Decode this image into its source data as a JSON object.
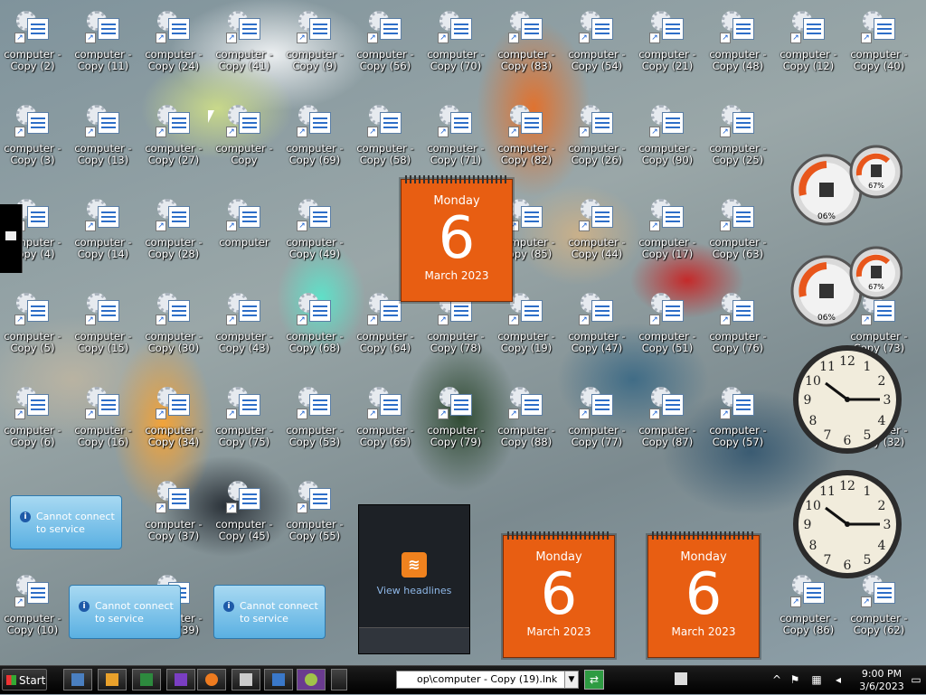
{
  "desktop": {
    "icons": [
      {
        "label1": "computer -",
        "label2": "Copy (2)",
        "col": 0,
        "row": 0
      },
      {
        "label1": "computer -",
        "label2": "Copy (11)",
        "col": 1,
        "row": 0
      },
      {
        "label1": "computer -",
        "label2": "Copy (24)",
        "col": 2,
        "row": 0
      },
      {
        "label1": "computer -",
        "label2": "Copy (41)",
        "col": 3,
        "row": 0
      },
      {
        "label1": "computer -",
        "label2": "Copy (9)",
        "col": 4,
        "row": 0
      },
      {
        "label1": "computer -",
        "label2": "Copy (56)",
        "col": 5,
        "row": 0
      },
      {
        "label1": "computer -",
        "label2": "Copy (70)",
        "col": 6,
        "row": 0
      },
      {
        "label1": "computer -",
        "label2": "Copy (83)",
        "col": 7,
        "row": 0
      },
      {
        "label1": "computer -",
        "label2": "Copy (54)",
        "col": 8,
        "row": 0
      },
      {
        "label1": "computer -",
        "label2": "Copy (21)",
        "col": 9,
        "row": 0
      },
      {
        "label1": "computer -",
        "label2": "Copy (48)",
        "col": 10,
        "row": 0
      },
      {
        "label1": "computer -",
        "label2": "Copy (12)",
        "col": 11,
        "row": 0
      },
      {
        "label1": "computer -",
        "label2": "Copy (40)",
        "col": 12,
        "row": 0
      },
      {
        "label1": "computer -",
        "label2": "Copy (3)",
        "col": 0,
        "row": 1
      },
      {
        "label1": "computer -",
        "label2": "Copy (13)",
        "col": 1,
        "row": 1
      },
      {
        "label1": "computer -",
        "label2": "Copy (27)",
        "col": 2,
        "row": 1
      },
      {
        "label1": "computer -",
        "label2": "Copy",
        "col": 3,
        "row": 1
      },
      {
        "label1": "computer -",
        "label2": "Copy (69)",
        "col": 4,
        "row": 1
      },
      {
        "label1": "computer -",
        "label2": "Copy (58)",
        "col": 5,
        "row": 1
      },
      {
        "label1": "computer -",
        "label2": "Copy (71)",
        "col": 6,
        "row": 1
      },
      {
        "label1": "computer -",
        "label2": "Copy (82)",
        "col": 7,
        "row": 1
      },
      {
        "label1": "computer -",
        "label2": "Copy (26)",
        "col": 8,
        "row": 1
      },
      {
        "label1": "computer -",
        "label2": "Copy (90)",
        "col": 9,
        "row": 1
      },
      {
        "label1": "computer -",
        "label2": "Copy (25)",
        "col": 10,
        "row": 1
      },
      {
        "label1": "computer -",
        "label2": "Copy (4)",
        "col": 0,
        "row": 2
      },
      {
        "label1": "computer -",
        "label2": "Copy (14)",
        "col": 1,
        "row": 2
      },
      {
        "label1": "computer -",
        "label2": "Copy (28)",
        "col": 2,
        "row": 2
      },
      {
        "label1": "computer",
        "label2": "",
        "col": 3,
        "row": 2
      },
      {
        "label1": "computer -",
        "label2": "Copy (49)",
        "col": 4,
        "row": 2
      },
      {
        "label1": "computer -",
        "label2": "Copy (85)",
        "col": 7,
        "row": 2
      },
      {
        "label1": "computer -",
        "label2": "Copy (44)",
        "col": 8,
        "row": 2
      },
      {
        "label1": "computer -",
        "label2": "Copy (17)",
        "col": 9,
        "row": 2
      },
      {
        "label1": "computer -",
        "label2": "Copy (63)",
        "col": 10,
        "row": 2
      },
      {
        "label1": "computer -",
        "label2": "Copy (5)",
        "col": 0,
        "row": 3
      },
      {
        "label1": "computer -",
        "label2": "Copy (15)",
        "col": 1,
        "row": 3
      },
      {
        "label1": "computer -",
        "label2": "Copy (30)",
        "col": 2,
        "row": 3
      },
      {
        "label1": "computer -",
        "label2": "Copy (43)",
        "col": 3,
        "row": 3
      },
      {
        "label1": "computer -",
        "label2": "Copy (68)",
        "col": 4,
        "row": 3
      },
      {
        "label1": "computer -",
        "label2": "Copy (64)",
        "col": 5,
        "row": 3
      },
      {
        "label1": "computer -",
        "label2": "Copy (78)",
        "col": 6,
        "row": 3
      },
      {
        "label1": "computer -",
        "label2": "Copy (19)",
        "col": 7,
        "row": 3
      },
      {
        "label1": "computer -",
        "label2": "Copy (47)",
        "col": 8,
        "row": 3
      },
      {
        "label1": "computer -",
        "label2": "Copy (51)",
        "col": 9,
        "row": 3
      },
      {
        "label1": "computer -",
        "label2": "Copy (76)",
        "col": 10,
        "row": 3
      },
      {
        "label1": "computer -",
        "label2": "Copy (73)",
        "col": 12,
        "row": 3
      },
      {
        "label1": "computer -",
        "label2": "Copy (6)",
        "col": 0,
        "row": 4
      },
      {
        "label1": "computer -",
        "label2": "Copy (16)",
        "col": 1,
        "row": 4
      },
      {
        "label1": "computer -",
        "label2": "Copy (34)",
        "col": 2,
        "row": 4
      },
      {
        "label1": "computer -",
        "label2": "Copy (75)",
        "col": 3,
        "row": 4
      },
      {
        "label1": "computer -",
        "label2": "Copy (53)",
        "col": 4,
        "row": 4
      },
      {
        "label1": "computer -",
        "label2": "Copy (65)",
        "col": 5,
        "row": 4
      },
      {
        "label1": "computer -",
        "label2": "Copy (79)",
        "col": 6,
        "row": 4
      },
      {
        "label1": "computer -",
        "label2": "Copy (88)",
        "col": 7,
        "row": 4
      },
      {
        "label1": "computer -",
        "label2": "Copy (77)",
        "col": 8,
        "row": 4
      },
      {
        "label1": "computer -",
        "label2": "Copy (87)",
        "col": 9,
        "row": 4
      },
      {
        "label1": "computer -",
        "label2": "Copy (57)",
        "col": 10,
        "row": 4
      },
      {
        "label1": "computer -",
        "label2": "Copy (32)",
        "col": 12,
        "row": 4
      },
      {
        "label1": "computer -",
        "label2": "Copy (37)",
        "col": 2,
        "row": 5
      },
      {
        "label1": "computer -",
        "label2": "Copy (45)",
        "col": 3,
        "row": 5
      },
      {
        "label1": "computer -",
        "label2": "Copy (55)",
        "col": 4,
        "row": 5
      },
      {
        "label1": "computer -",
        "label2": "Copy (10)",
        "col": 0,
        "row": 6
      },
      {
        "label1": "computer -",
        "label2": "Copy (39)",
        "col": 2,
        "row": 6
      },
      {
        "label1": "computer -",
        "label2": "Copy (86)",
        "col": 11,
        "row": 6
      },
      {
        "label1": "computer -",
        "label2": "Copy (62)",
        "col": 12,
        "row": 6
      }
    ]
  },
  "gadgets": {
    "calendar": {
      "day": "Monday",
      "date": "6",
      "month": "March 2023"
    },
    "feed": {
      "link": "View headlines",
      "rss_glyph": "≋"
    },
    "notice_text": "Cannot connect to service",
    "notice_info": "i",
    "cpu_meter": {
      "left": "06%",
      "right": "67%"
    }
  },
  "taskbar": {
    "start_label": "Start",
    "address_value": "op\\computer - Copy (19).lnk",
    "address_drop": "▼",
    "go_glyph": "⇄",
    "time": "9:00 PM",
    "date": "3/6/2023"
  },
  "icons": {
    "start": "windows-flag-icon",
    "tray": [
      "chevron-up-icon",
      "flag-icon",
      "network-icon",
      "speaker-icon",
      "keyboard-icon"
    ]
  }
}
